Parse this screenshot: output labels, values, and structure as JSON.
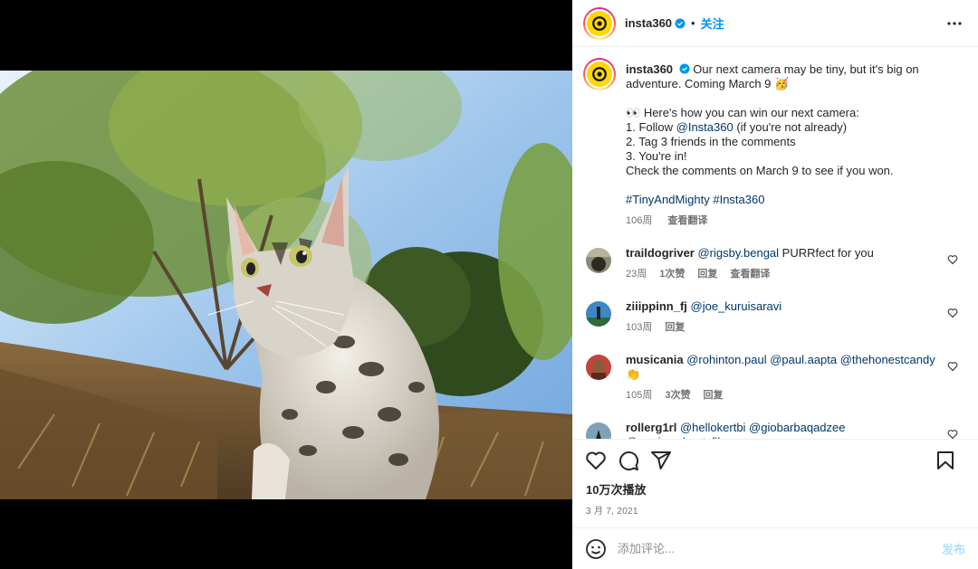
{
  "account": {
    "username": "insta360",
    "follow_label": "关注",
    "verified": true,
    "dot": "•"
  },
  "colors": {
    "accent": "#0095f6",
    "brand_yellow": "#ffd800",
    "text": "#262626",
    "muted": "#737373",
    "link": "#00376b"
  },
  "caption": {
    "username": "insta360",
    "text1": "Our next camera may be tiny, but it's big on",
    "text2": "adventure. Coming March 9 🥳",
    "line3_emoji": "👀",
    "line3": "Here's how you can win our next camera:",
    "line4_pre": "1. Follow ",
    "line4_mention": "@Insta360",
    "line4_post": " (if you're not already)",
    "line5": "2. Tag 3 friends in the comments",
    "line6": "3. You're in!",
    "line7": "Check the comments on March 9 to see if you won.",
    "hashtag1": "#TinyAndMighty",
    "hashtag2": "#Insta360",
    "age": "106周",
    "translate": "查看翻译"
  },
  "comments": [
    {
      "username": "traildogriver",
      "mention": "@rigsby.bengal",
      "text": " PURRfect for you",
      "age": "23周",
      "likes": "1次赞",
      "reply": "回复",
      "translate": "查看翻译"
    },
    {
      "username": "ziiippinn_fj",
      "mention": "@joe_kuruisaravi",
      "text": "",
      "age": "103周",
      "reply": "回复"
    },
    {
      "username": "musicania",
      "mention": "@rohinton.paul @paul.aapta @thehonestcandy",
      "text": " 👏",
      "age": "105周",
      "likes": "3次赞",
      "reply": "回复"
    },
    {
      "username": "rollerg1rl",
      "mention": "@hellokertbi @giobarbaqadzee @mariamshootsfilm",
      "text": "🔥"
    }
  ],
  "post": {
    "views": "10万次播放",
    "date": "3 月 7, 2021"
  },
  "composer": {
    "placeholder": "添加评论...",
    "post_label": "发布"
  },
  "icons": [
    "more-icon",
    "verified-icon",
    "heart-icon",
    "comment-icon",
    "share-icon",
    "bookmark-icon",
    "emoji-icon",
    "mute-icon"
  ]
}
